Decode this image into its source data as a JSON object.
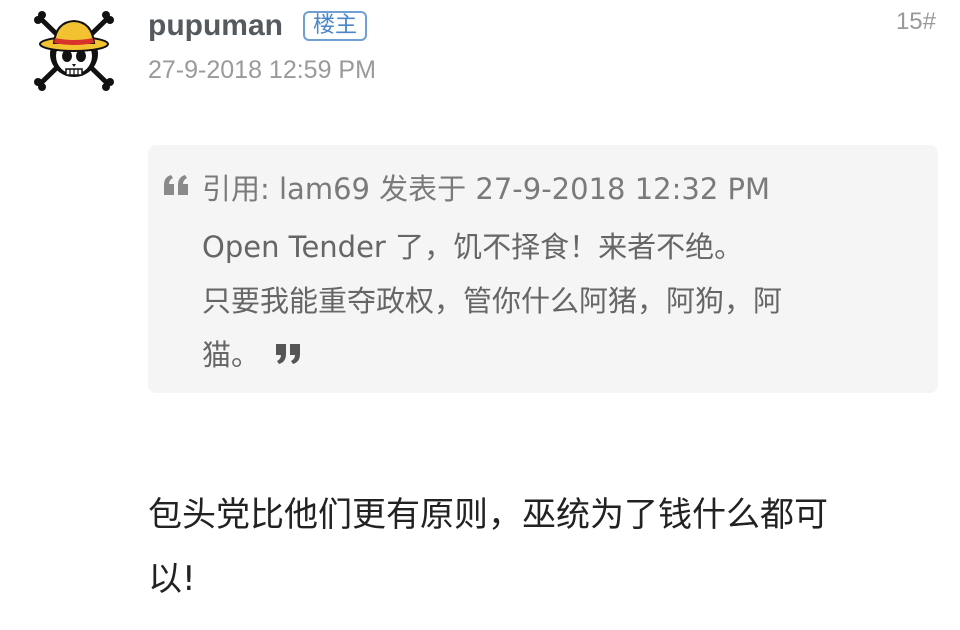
{
  "post": {
    "author": "pupuman",
    "op_badge": "楼主",
    "floor": "15#",
    "time": "27-9-2018 12:59 PM",
    "avatar_icon": "straw-hat-skull-icon",
    "quote": {
      "header": "引用: lam69 发表于 27-9-2018 12:32 PM",
      "lines": [
        "Open Tender 了，饥不择食！来者不绝。",
        "只要我能重夺政权，管你什么阿猪，阿狗，阿",
        "猫。"
      ],
      "open_icon": "quote-open-icon",
      "close_icon": "quote-close-icon"
    },
    "body_lines": [
      "包头党比他们更有原则，巫统为了钱什么都可",
      "以!"
    ]
  },
  "colors": {
    "badge_blue": "#4a86c8",
    "quote_bg": "#f5f5f5",
    "muted_gray": "#9a9a9a"
  }
}
